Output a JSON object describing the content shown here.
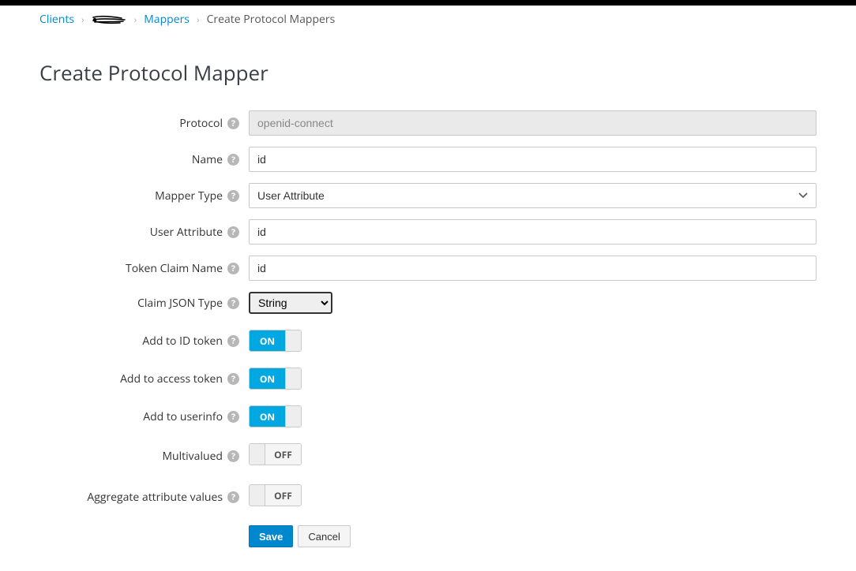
{
  "breadcrumb": {
    "clients": "Clients",
    "mappers": "Mappers",
    "current": "Create Protocol Mappers"
  },
  "page": {
    "title": "Create Protocol Mapper"
  },
  "labels": {
    "protocol": "Protocol",
    "name": "Name",
    "mapper_type": "Mapper Type",
    "user_attribute": "User Attribute",
    "token_claim_name": "Token Claim Name",
    "claim_json_type": "Claim JSON Type",
    "add_id_token": "Add to ID token",
    "add_access_token": "Add to access token",
    "add_userinfo": "Add to userinfo",
    "multivalued": "Multivalued",
    "aggregate": "Aggregate attribute values"
  },
  "values": {
    "protocol": "openid-connect",
    "name": "id",
    "mapper_type": "User Attribute",
    "user_attribute": "id",
    "token_claim_name": "id",
    "claim_json_type": "String",
    "add_id_token": "ON",
    "add_access_token": "ON",
    "add_userinfo": "ON",
    "multivalued": "OFF",
    "aggregate": "OFF"
  },
  "buttons": {
    "save": "Save",
    "cancel": "Cancel"
  },
  "toggle": {
    "on": "ON",
    "off": "OFF"
  },
  "mapper_type_options": [
    "User Attribute"
  ],
  "claim_json_type_options": [
    "String"
  ]
}
